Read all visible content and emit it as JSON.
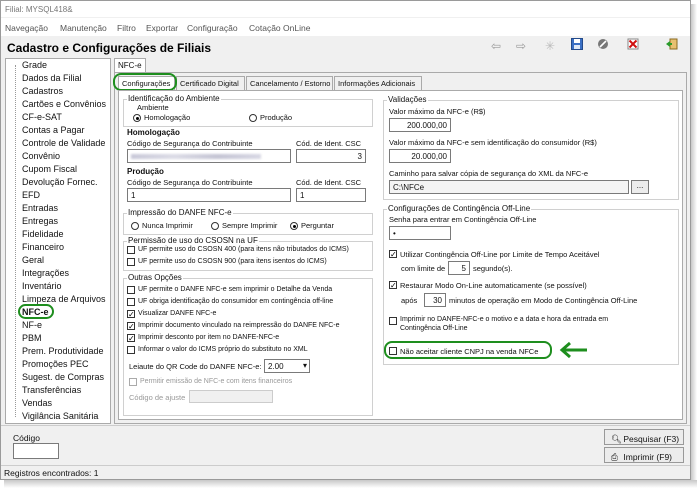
{
  "window": {
    "title": "Filial: MYSQL418&"
  },
  "menu": [
    "Navegação",
    "Manutenção",
    "Filtro",
    "Exportar",
    "Configuração",
    "Cotação OnLine"
  ],
  "header": {
    "title": "Cadastro e Configurações de Filiais"
  },
  "toolbar_icons": [
    "arrow-left-icon",
    "arrow-right-icon",
    "star-icon",
    "save-icon",
    "cancel-icon",
    "delete-icon",
    "exit-icon"
  ],
  "sidebar": {
    "items": [
      "Grade",
      "Dados da Filial",
      "Cadastros",
      "Cartões e Convênios",
      "CF-e-SAT",
      "Contas a Pagar",
      "Controle de Validade",
      "Convênio",
      "Cupom Fiscal",
      "Devolução Fornec.",
      "EFD",
      "Entradas",
      "Entregas",
      "Fidelidade",
      "Financeiro",
      "Geral",
      "Integrações",
      "Inventário",
      "Limpeza de Arquivos",
      "NFC-e",
      "NF-e",
      "PBM",
      "Prem. Produtividade",
      "Promoções PEC",
      "Sugest. de Compras",
      "Transferências",
      "Vendas",
      "Vigilância Sanitária"
    ],
    "selected": "NFC-e"
  },
  "main_tab": "NFC-e",
  "subtabs": [
    "Configurações",
    "Certificado Digital",
    "Cancelamento / Estorno",
    "Informações Adicionais"
  ],
  "identificacao": {
    "title": "Identificação do Ambiente",
    "ambiente_label": "Ambiente",
    "options": [
      "Homologação",
      "Produção"
    ],
    "selected": "Homologação"
  },
  "homologacao": {
    "title": "Homologação",
    "csc_label": "Código de Segurança do Contribuinte",
    "id_label": "Cód. de Ident. CSC",
    "id_value": "3"
  },
  "producao": {
    "title": "Produção",
    "csc_label": "Código de Segurança do Contribuinte",
    "csc_value": "1",
    "id_label": "Cód. de Ident. CSC",
    "id_value": "1"
  },
  "impressao": {
    "title": "Impressão do DANFE NFC-e",
    "options": [
      "Nunca Imprimir",
      "Sempre Imprimir",
      "Perguntar"
    ],
    "selected": "Perguntar"
  },
  "csosn": {
    "title": "Permissão de uso do CSOSN na UF",
    "items": [
      {
        "label": "UF permite uso do CSOSN 400 (para itens não tributados do ICMS)",
        "checked": false
      },
      {
        "label": "UF permite uso do CSOSN 900 (para itens isentos do ICMS)",
        "checked": false
      }
    ]
  },
  "outras": {
    "title": "Outras Opções",
    "items": [
      {
        "label": "UF permite o DANFE NFC-e sem imprimir o Detalhe da Venda",
        "checked": false
      },
      {
        "label": "UF obriga identificação do consumidor em contingência off-line",
        "checked": false
      },
      {
        "label": "Visualizar DANFE NFC-e",
        "checked": true
      },
      {
        "label": "Imprimir documento vinculado na reimpressão do DANFE NFC-e",
        "checked": true
      },
      {
        "label": "Imprimir desconto por item no DANFE-NFC-e",
        "checked": true
      },
      {
        "label": "Informar o valor do ICMS próprio do substituto no XML",
        "checked": false
      }
    ],
    "qr_label": "Leiaute do QR Code do DANFE NFC-e:",
    "qr_value": "2.00",
    "financeiros_label": "Permitir emissão de NFC-e com itens financeiros",
    "ajuste_label": "Código de ajuste"
  },
  "validacoes": {
    "title": "Validações",
    "max_label": "Valor máximo da NFC-e (R$)",
    "max_value": "200.000,00",
    "max_sem_label": "Valor máximo da NFC-e sem identificação do consumidor (R$)",
    "max_sem_value": "20.000,00",
    "caminho_label": "Caminho para salvar cópia de segurança do XML da NFC-e",
    "caminho_value": "C:\\NFCe",
    "browse_label": "..."
  },
  "contingencia": {
    "title": "Configurações de Contingência Off-Line",
    "senha_label": "Senha para entrar em Contingência Off-Line",
    "senha_value": "•",
    "utilizar_label": "Utilizar Contingência Off-Line por Limite de Tempo Aceitável",
    "com_limite_label": "com limite de",
    "limite_value": "5",
    "segundos_label": "segundo(s).",
    "restaurar_label": "Restaurar Modo On-Line automaticamente (se possível)",
    "apos_label": "após",
    "apos_value": "30",
    "minutos_label": "minutos de operação em Modo de Contingência Off-Line",
    "imprimir_label": "Imprimir no DANFE-NFC-e o motivo e a data e hora da entrada em",
    "imprimir_label2": "Contingência Off-Line",
    "nao_aceitar_label": "Não aceitar cliente CNPJ na venda NFCe"
  },
  "footer": {
    "codigo_label": "Código",
    "pesquisar_label": "Pesquisar (F3)",
    "imprimir_label": "Imprimir (F9)"
  },
  "status": {
    "text": "Registros encontrados: 1"
  },
  "colors": {
    "highlight": "#1e8e1e",
    "window_bg": "#f0f0f0"
  }
}
